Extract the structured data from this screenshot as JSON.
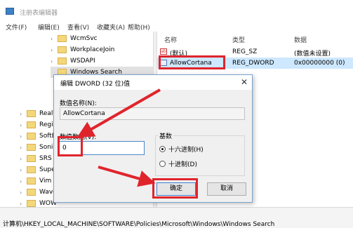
{
  "window": {
    "title": "注册表编辑器"
  },
  "menu": [
    "文件(F)",
    "编辑(E)",
    "查看(V)",
    "收藏夹(A)",
    "帮助(H)"
  ],
  "tree": {
    "items": [
      {
        "label": "WcmSvc"
      },
      {
        "label": "WorkplaceJoin"
      },
      {
        "label": "WSDAPI"
      },
      {
        "label": "Windows Search"
      },
      {
        "label": "Realt"
      },
      {
        "label": "Regis"
      },
      {
        "label": "SoftE"
      },
      {
        "label": "Sonic"
      },
      {
        "label": "SRS I"
      },
      {
        "label": "Super"
      },
      {
        "label": "Vim"
      },
      {
        "label": "Wave"
      },
      {
        "label": "WOW"
      }
    ]
  },
  "values_pane": {
    "headers": {
      "name": "名称",
      "type": "类型",
      "data": "数据"
    },
    "rows": [
      {
        "name": "(默认)",
        "type": "REG_SZ",
        "data": "(数值未设置)",
        "icon": "string-value-icon"
      },
      {
        "name": "AllowCortana",
        "type": "REG_DWORD",
        "data": "0x00000000 (0)",
        "icon": "dword-value-icon"
      }
    ]
  },
  "dialog": {
    "title": "编辑 DWORD (32 位)值",
    "close": "✕",
    "name_label": "数值名称(N):",
    "name_value": "AllowCortana",
    "data_label": "数值数据(V):",
    "data_value": "0",
    "radix_label": "基数",
    "radix_hex": "十六进制(H)",
    "radix_dec": "十进制(D)",
    "radix_selected": "hex",
    "ok": "确定",
    "cancel": "取消"
  },
  "status": {
    "path": "计算机\\HKEY_LOCAL_MACHINE\\SOFTWARE\\Policies\\Microsoft\\Windows\\Windows Search"
  },
  "colors": {
    "highlight": "#e0242c",
    "selection": "#cde8ff",
    "dialog_bg": "#f0f0f0"
  }
}
